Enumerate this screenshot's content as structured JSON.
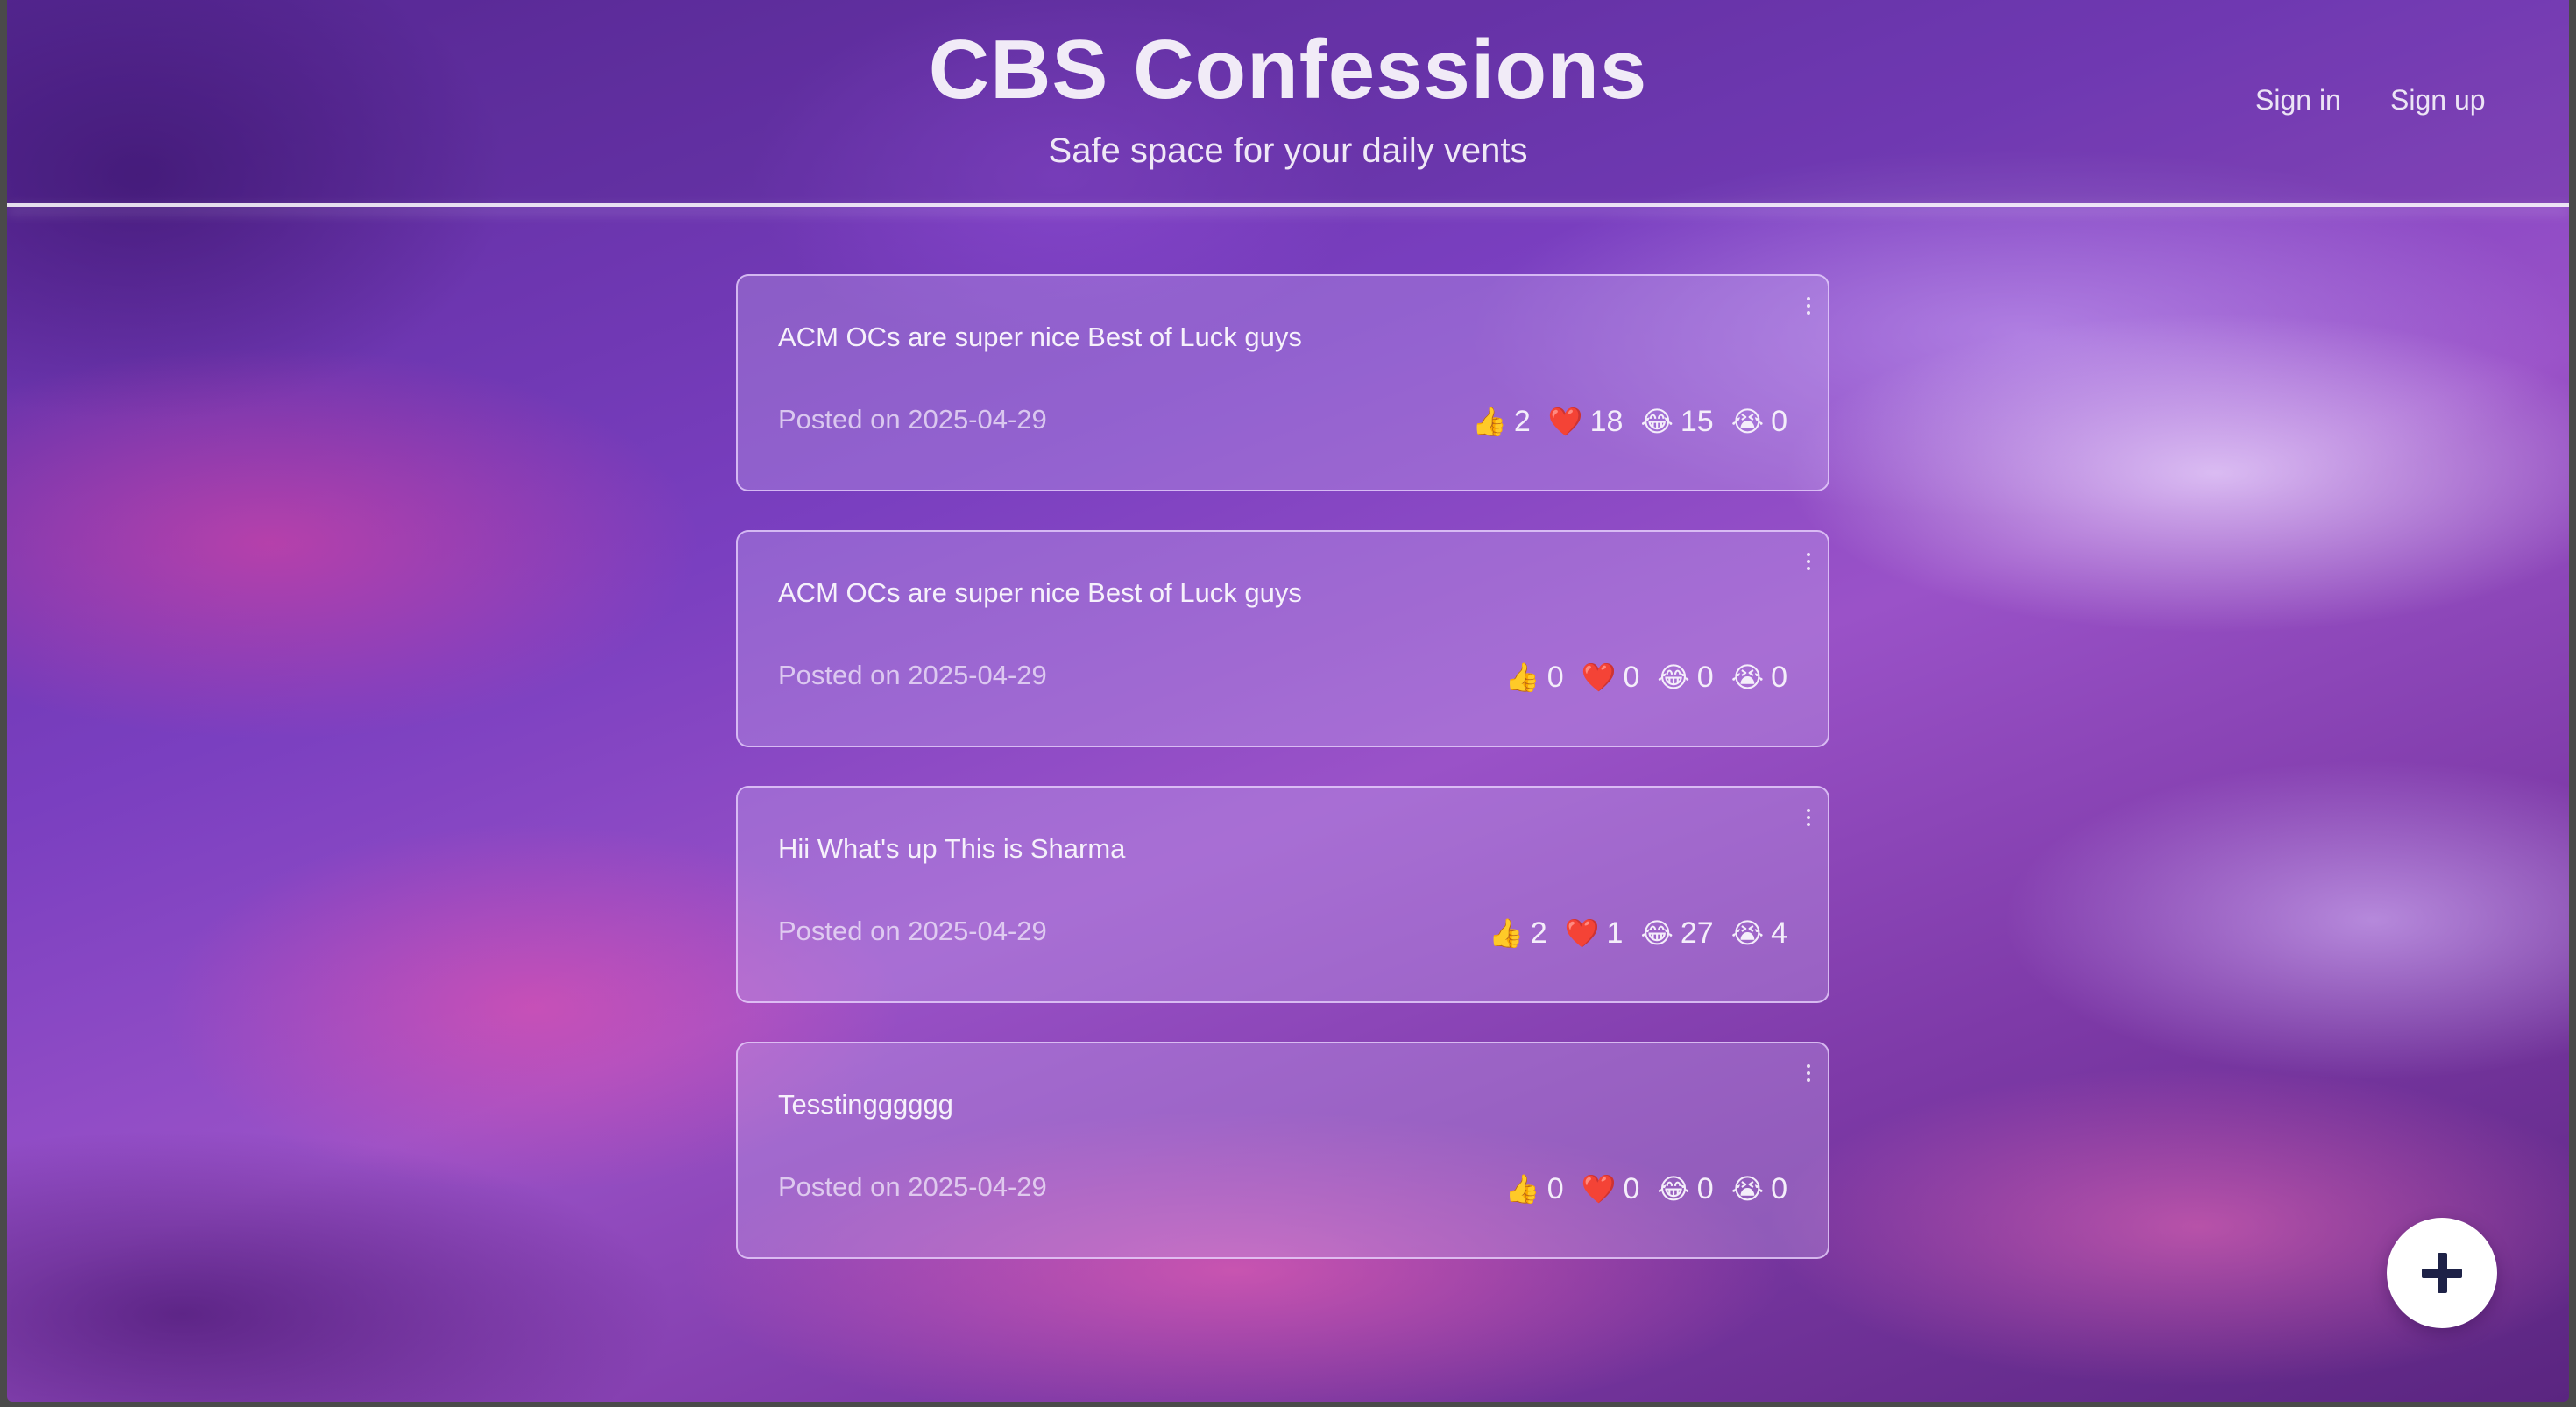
{
  "header": {
    "title": "CBS Confessions",
    "subtitle": "Safe space for your daily vents",
    "nav": {
      "sign_in": "Sign in",
      "sign_up": "Sign up"
    }
  },
  "posts": [
    {
      "text": "ACM OCs are super nice Best of Luck guys",
      "date": "Posted on 2025-04-29",
      "reactions": {
        "thumbs_up": "2",
        "heart": "18",
        "laugh": "15",
        "cry": "0"
      }
    },
    {
      "text": "ACM OCs are super nice Best of Luck guys",
      "date": "Posted on 2025-04-29",
      "reactions": {
        "thumbs_up": "0",
        "heart": "0",
        "laugh": "0",
        "cry": "0"
      }
    },
    {
      "text": "Hii What's up This is Sharma",
      "date": "Posted on 2025-04-29",
      "reactions": {
        "thumbs_up": "2",
        "heart": "1",
        "laugh": "27",
        "cry": "4"
      }
    },
    {
      "text": "Tesstingggggg",
      "date": "Posted on 2025-04-29",
      "reactions": {
        "thumbs_up": "0",
        "heart": "0",
        "laugh": "0",
        "cry": "0"
      }
    }
  ],
  "reaction_icons": {
    "thumbs_up": "👍",
    "heart": "❤️",
    "laugh": "😂",
    "cry": "😭"
  },
  "colors": {
    "fab_background": "#ffffff",
    "fab_icon": "#1e2247",
    "header_rule": "#ffffff"
  }
}
